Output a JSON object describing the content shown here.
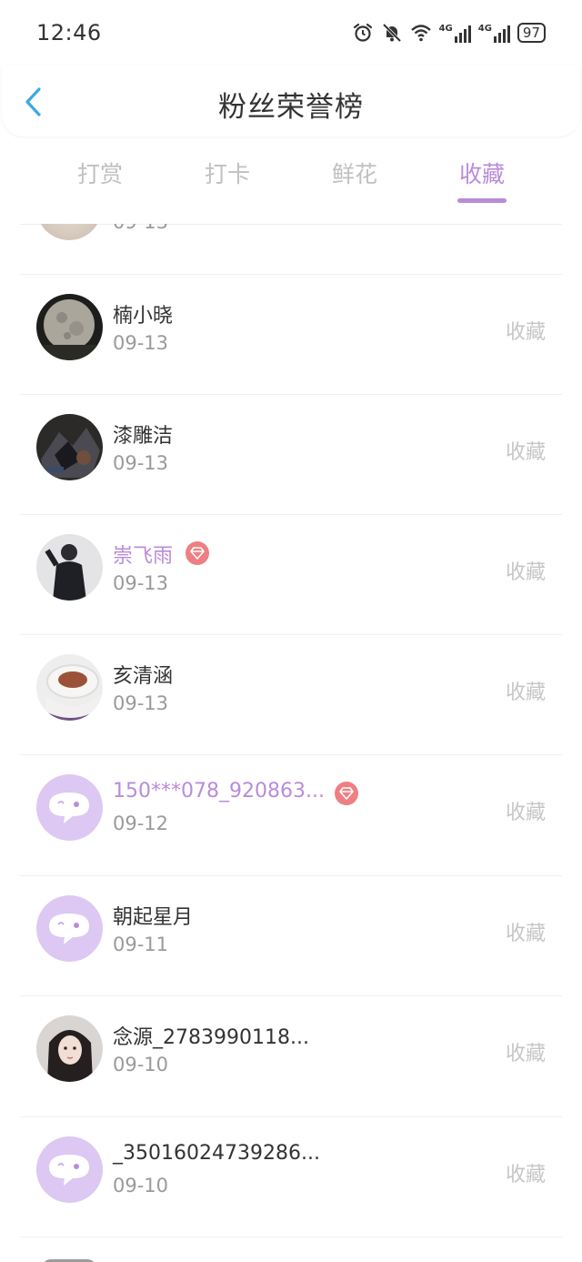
{
  "status_bar": {
    "time": "12:46",
    "icons": [
      "alarm-icon",
      "mute-bell-icon",
      "wifi-icon",
      "signal-4g-icon",
      "signal-4g-icon"
    ],
    "network_label_1": "4G",
    "network_label_2": "4G",
    "battery": "97"
  },
  "header": {
    "back_icon": "chevron-left-icon",
    "title": "粉丝荣誉榜"
  },
  "tabs": [
    {
      "label": "打赏",
      "active": false
    },
    {
      "label": "打卡",
      "active": false
    },
    {
      "label": "鲜花",
      "active": false
    },
    {
      "label": "收藏",
      "active": true
    }
  ],
  "colors": {
    "accent": "#b98cd9",
    "vip_badge": "#ee7f83",
    "muted_text": "#9a9a9a",
    "action_text": "#c6c6c6",
    "default_avatar_bg": "#dcc8f2"
  },
  "list": {
    "partial_top_date": "09-13",
    "items": [
      {
        "name": "楠小晓",
        "date": "09-13",
        "action": "收藏",
        "vip": false,
        "avatar": "moon-photo-avatar"
      },
      {
        "name": "漆雕洁",
        "date": "09-13",
        "action": "收藏",
        "vip": false,
        "avatar": "dark-photo-avatar"
      },
      {
        "name": "崇飞雨",
        "date": "09-13",
        "action": "收藏",
        "vip": true,
        "avatar": "person-photo-avatar"
      },
      {
        "name": "亥清涵",
        "date": "09-13",
        "action": "收藏",
        "vip": false,
        "avatar": "coffee-photo-avatar"
      },
      {
        "name": "150***078_920863...",
        "date": "09-12",
        "action": "收藏",
        "vip": true,
        "avatar": "default-chat-avatar"
      },
      {
        "name": "朝起星月",
        "date": "09-11",
        "action": "收藏",
        "vip": false,
        "avatar": "default-chat-avatar"
      },
      {
        "name": "念源_2783990118...",
        "date": "09-10",
        "action": "收藏",
        "vip": false,
        "avatar": "girl-photo-avatar"
      },
      {
        "name": "_35016024739286...",
        "date": "09-10",
        "action": "收藏",
        "vip": false,
        "avatar": "default-chat-avatar"
      }
    ]
  }
}
